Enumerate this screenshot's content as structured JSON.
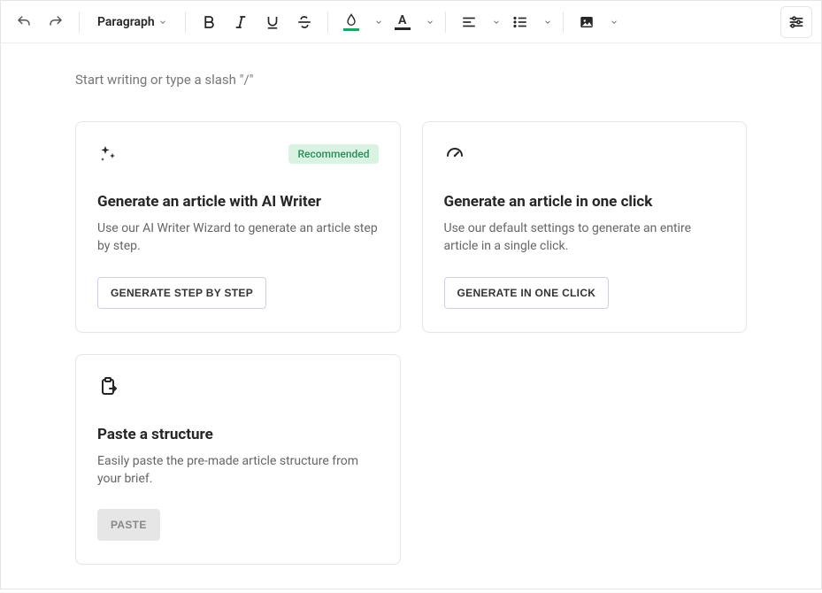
{
  "toolbar": {
    "format_label": "Paragraph",
    "highlight_color": "#1fa366",
    "text_color": "#262626"
  },
  "editor": {
    "placeholder": "Start writing or type a slash \"/\""
  },
  "cards": {
    "ai_wizard": {
      "badge": "Recommended",
      "title": "Generate an article with AI Writer",
      "desc": "Use our AI Writer Wizard to generate an article step by step.",
      "button": "GENERATE STEP BY STEP"
    },
    "one_click": {
      "title": "Generate an article in one click",
      "desc": "Use our default settings to generate an entire article in a single click.",
      "button": "GENERATE IN ONE CLICK"
    },
    "paste": {
      "title": "Paste a structure",
      "desc": "Easily paste the pre-made article structure from your brief.",
      "button": "PASTE"
    }
  }
}
